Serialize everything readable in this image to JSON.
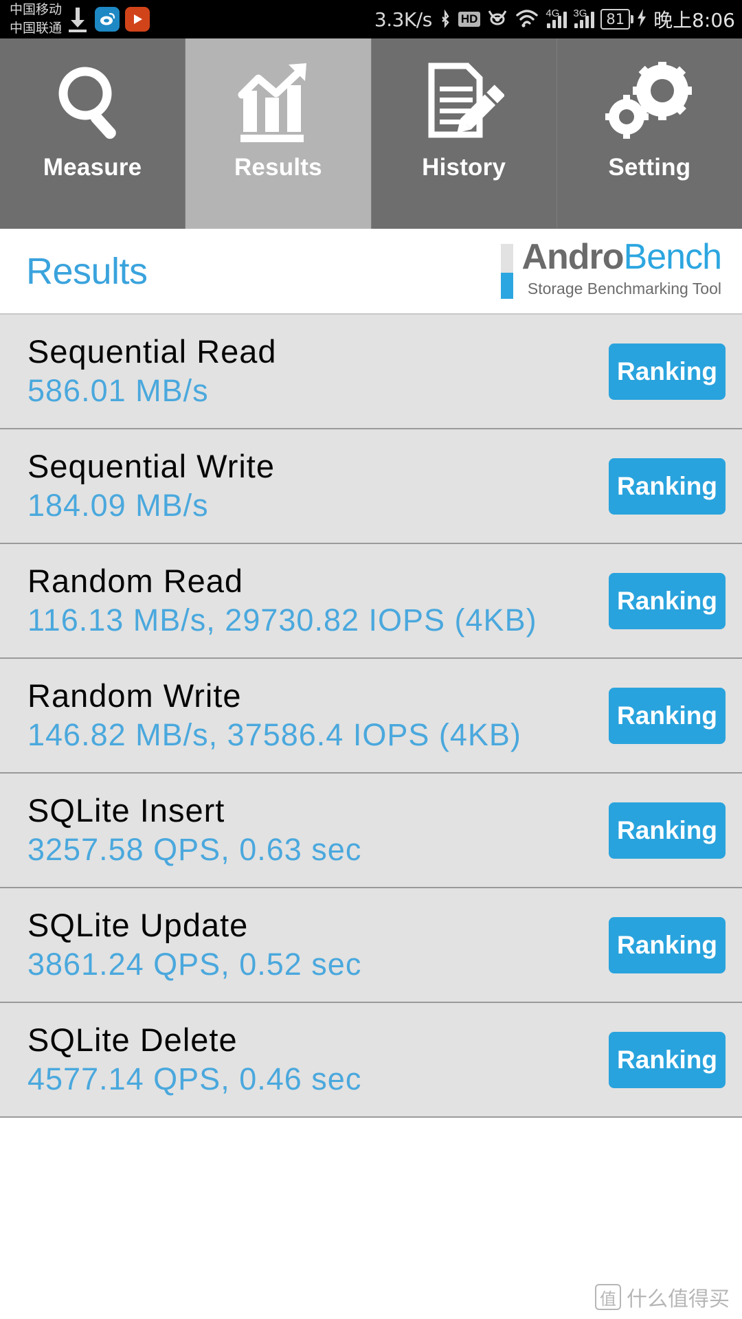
{
  "statusbar": {
    "carrier_line1": "中国移动",
    "carrier_line2": "中国联通",
    "download_icon": "download-arrow-icon",
    "app_icon_1": "weibo-app-icon",
    "app_icon_2": "video-player-app-icon",
    "network_speed": "3.3K/s",
    "bluetooth_icon": "bluetooth-icon",
    "hd_label": "HD",
    "eye_icon": "eye-care-icon",
    "wifi_icon": "wifi-icon",
    "sim1_network": "4G",
    "sim2_network": "3G",
    "battery_percent": "81",
    "charging_icon": "charging-bolt-icon",
    "time": "晚上8:06"
  },
  "tabs": [
    {
      "label": "Measure",
      "icon": "magnifier-icon",
      "active": false
    },
    {
      "label": "Results",
      "icon": "bar-chart-trend-icon",
      "active": true
    },
    {
      "label": "History",
      "icon": "document-pencil-icon",
      "active": false
    },
    {
      "label": "Setting",
      "icon": "gears-icon",
      "active": false
    }
  ],
  "header": {
    "page_title": "Results",
    "brand_first": "Andro",
    "brand_second": "Bench",
    "brand_subtitle": "Storage Benchmarking Tool"
  },
  "results": {
    "ranking_label": "Ranking",
    "rows": [
      {
        "title": "Sequential Read",
        "value": "586.01 MB/s"
      },
      {
        "title": "Sequential Write",
        "value": "184.09 MB/s"
      },
      {
        "title": "Random Read",
        "value": "116.13 MB/s, 29730.82 IOPS (4KB)"
      },
      {
        "title": "Random Write",
        "value": "146.82 MB/s, 37586.4 IOPS (4KB)"
      },
      {
        "title": "SQLite Insert",
        "value": "3257.58 QPS, 0.63 sec"
      },
      {
        "title": "SQLite Update",
        "value": "3861.24 QPS, 0.52 sec"
      },
      {
        "title": "SQLite Delete",
        "value": "4577.14 QPS, 0.46 sec"
      }
    ]
  },
  "watermark": {
    "logo_char": "值",
    "text": "什么值得买"
  },
  "colors": {
    "accent_blue": "#29a3dd",
    "value_blue": "#4aa8dd",
    "title_blue": "#3aa3dd",
    "tab_inactive": "#6e6e6e",
    "tab_active": "#b4b4b4",
    "row_bg": "#e2e2e2"
  }
}
